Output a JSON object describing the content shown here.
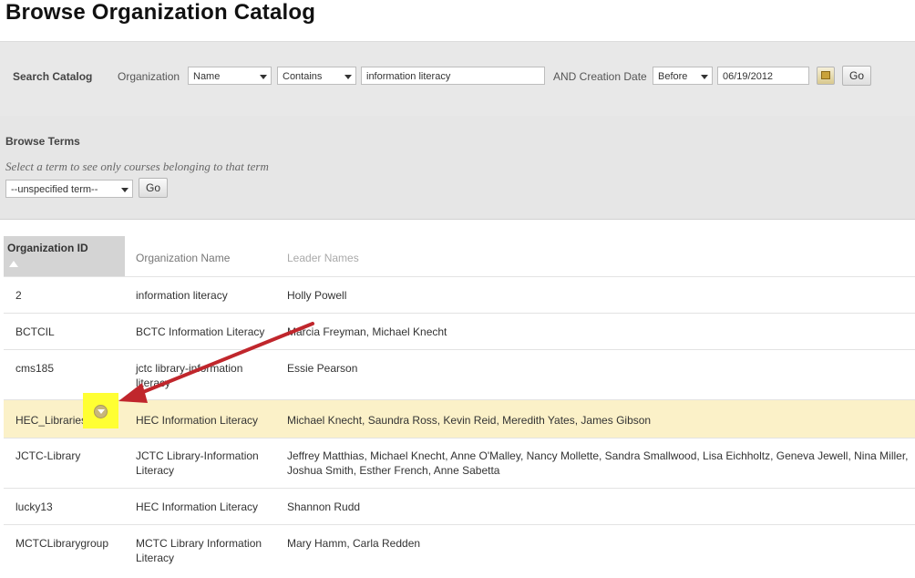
{
  "page": {
    "title": "Browse Organization Catalog"
  },
  "search": {
    "label": "Search Catalog",
    "organization_label": "Organization",
    "field_select": "Name",
    "operator_select": "Contains",
    "term_value": "information literacy",
    "and_label": "AND Creation Date",
    "date_operator": "Before",
    "date_value": "06/19/2012",
    "go_label": "Go"
  },
  "browse": {
    "title": "Browse Terms",
    "hint": "Select a term to see only courses belonging to that term",
    "term_select": "--unspecified term--",
    "go_label": "Go"
  },
  "table": {
    "columns": [
      "Organization ID",
      "Organization Name",
      "Leader Names"
    ],
    "rows": [
      {
        "id": "2",
        "name": "information literacy",
        "leaders": "Holly Powell"
      },
      {
        "id": "BCTCIL",
        "name": "BCTC Information Literacy",
        "leaders": "Marcia Freyman, Michael Knecht"
      },
      {
        "id": "cms185",
        "name": "jctc library-information literacy",
        "leaders": "Essie Pearson"
      },
      {
        "id": "HEC_Libraries",
        "name": "HEC Information Literacy",
        "leaders": "Michael Knecht, Saundra Ross, Kevin Reid, Meredith Yates, James Gibson"
      },
      {
        "id": "JCTC-Library",
        "name": "JCTC Library-Information Literacy",
        "leaders": "Jeffrey Matthias, Michael Knecht, Anne O'Malley, Nancy Mollette, Sandra Smallwood, Lisa Eichholtz, Geneva Jewell, Nina Miller, Joshua Smith, Esther French, Anne Sabetta"
      },
      {
        "id": "lucky13",
        "name": "HEC Information Literacy",
        "leaders": "Shannon Rudd"
      },
      {
        "id": "MCTCLibrarygroup",
        "name": "MCTC Library Information Literacy",
        "leaders": "Mary Hamm, Carla Redden"
      }
    ]
  },
  "colors": {
    "highlight_row": "#fbf1c8",
    "marker": "#ffff33",
    "arrow": "#c0262c"
  }
}
